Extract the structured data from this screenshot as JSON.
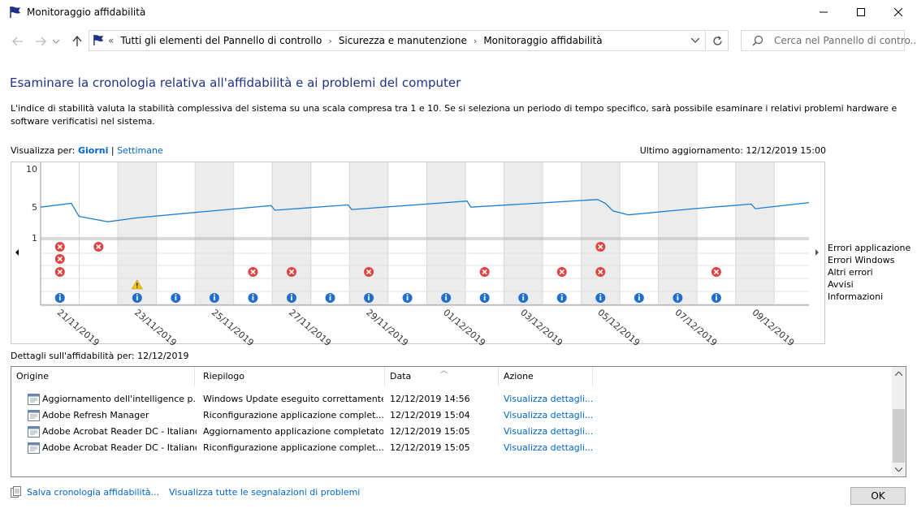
{
  "window": {
    "title": "Monitoraggio affidabilità"
  },
  "address": {
    "crumbs": [
      "Tutti gli elementi del Pannello di controllo",
      "Sicurezza e manutenzione",
      "Monitoraggio affidabilità"
    ],
    "search_placeholder": "Cerca nel Pannello di contro..."
  },
  "page": {
    "heading": "Esaminare la cronologia relativa all'affidabilità e ai problemi del computer",
    "description": "L'indice di stabilità valuta la stabilità complessiva del sistema su una scala compresa tra 1 e 10. Se si seleziona un periodo di tempo specifico, sarà possibile esaminare i relativi problemi hardware e software verificatisi nel sistema.",
    "view_by_label": "Visualizza per:",
    "view_days": "Giorni",
    "view_sep": "|",
    "view_weeks": "Settimane",
    "last_update": "Ultimo aggiornamento: 12/12/2019 15:00"
  },
  "chart_data": {
    "type": "line",
    "y_ticks": [
      "10",
      "5",
      "1"
    ],
    "ylim": [
      1,
      10
    ],
    "x_labels": [
      "21/11/2019",
      "23/11/2019",
      "25/11/2019",
      "27/11/2019",
      "29/11/2019",
      "01/12/2019",
      "03/12/2019",
      "05/12/2019",
      "07/12/2019",
      "09/12/2019"
    ],
    "days": 20,
    "stability_index": [
      5.3,
      5.0,
      3.8,
      3.8,
      4.1,
      4.4,
      4.6,
      4.8,
      4.7,
      4.4,
      4.6,
      4.6,
      4.8,
      4.9,
      5.0,
      5.1,
      5.2,
      5.3,
      5.4,
      5.5,
      5.6,
      4.8,
      4.5,
      4.8,
      4.5,
      4.8,
      4.9,
      5.0,
      5.1,
      5.3
    ],
    "stability_line": [
      [
        0,
        5.0
      ],
      [
        0.8,
        5.5
      ],
      [
        1,
        3.8
      ],
      [
        1.75,
        3.1
      ],
      [
        2.5,
        3.6
      ],
      [
        4,
        4.3
      ],
      [
        6,
        5.2
      ],
      [
        6.1,
        4.6
      ],
      [
        8,
        5.3
      ],
      [
        8.1,
        4.7
      ],
      [
        11.1,
        5.8
      ],
      [
        11.2,
        5.0
      ],
      [
        14.5,
        6.0
      ],
      [
        14.7,
        5.5
      ],
      [
        14.9,
        4.5
      ],
      [
        15.3,
        4.0
      ],
      [
        17,
        4.8
      ],
      [
        18.5,
        5.4
      ],
      [
        18.6,
        4.8
      ],
      [
        20,
        5.6
      ]
    ],
    "row_labels": [
      "Errori applicazione",
      "Errori Windows",
      "Altri errori",
      "Avvisi",
      "Informazioni"
    ],
    "events": {
      "app_errors": [
        0,
        1,
        14
      ],
      "windows_errors": [
        0
      ],
      "other_errors": [
        0,
        5,
        6,
        8,
        11,
        13,
        14,
        17
      ],
      "warnings": [
        2
      ],
      "info": [
        0,
        2,
        3,
        4,
        5,
        6,
        7,
        8,
        9,
        10,
        11,
        12,
        13,
        14,
        15,
        16,
        17
      ]
    },
    "shaded_columns": [
      2,
      4,
      6,
      8,
      10,
      12,
      14,
      16,
      18
    ],
    "colors": {
      "line": "#1a7fd4",
      "error": "#e04343",
      "info": "#1f6fd1",
      "warning": "#f2c40f",
      "shade": "#ececec"
    }
  },
  "details": {
    "title": "Dettagli sull'affidabilità per: 12/12/2019",
    "columns": [
      "Origine",
      "Riepilogo",
      "Data",
      "Azione"
    ],
    "rows": [
      {
        "origin": "Aggiornamento dell'intelligence p...",
        "summary": "Windows Update eseguito correttamente",
        "date": "12/12/2019 14:56",
        "action": "Visualizza dettagli..."
      },
      {
        "origin": "Adobe Refresh Manager",
        "summary": "Riconfigurazione applicazione complet...",
        "date": "12/12/2019 15:04",
        "action": "Visualizza dettagli..."
      },
      {
        "origin": "Adobe Acrobat Reader DC - Italiano",
        "summary": "Aggiornamento applicazione completato",
        "date": "12/12/2019 15:05",
        "action": "Visualizza dettagli..."
      },
      {
        "origin": "Adobe Acrobat Reader DC - Italiano",
        "summary": "Riconfigurazione applicazione complet...",
        "date": "12/12/2019 15:05",
        "action": "Visualizza dettagli..."
      }
    ]
  },
  "footer": {
    "save_link": "Salva cronologia affidabilità...",
    "all_reports_link": "Visualizza tutte le segnalazioni di problemi",
    "ok": "OK"
  }
}
